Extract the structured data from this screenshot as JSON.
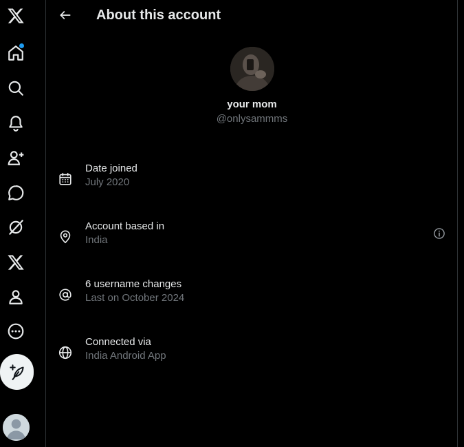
{
  "header": {
    "title": "About this account",
    "back_icon": "arrow-left-icon"
  },
  "profile": {
    "name": "your mom",
    "handle": "@onlysammms"
  },
  "info": [
    {
      "label": "Date joined",
      "value": "July 2020",
      "icon": "calendar-icon"
    },
    {
      "label": "Account based in",
      "value": "India",
      "icon": "location-pin-icon",
      "has_help": true
    },
    {
      "label": "6 username changes",
      "value": "Last on October 2024",
      "icon": "at-sign-icon"
    },
    {
      "label": "Connected via",
      "value": "India Android App",
      "icon": "globe-icon"
    }
  ],
  "nav": {
    "items": [
      "x-logo-icon",
      "home-icon",
      "search-icon",
      "notifications-icon",
      "follow-icon",
      "messages-icon",
      "grok-icon",
      "premium-x-icon",
      "profile-icon",
      "more-icon"
    ],
    "home_has_notification": true,
    "post_icon": "compose-icon",
    "accent_color": "#1d9bf0"
  },
  "colors": {
    "background": "#000000",
    "text_primary": "#e7e9ea",
    "text_secondary": "#71767b",
    "divider": "#2f3336"
  }
}
